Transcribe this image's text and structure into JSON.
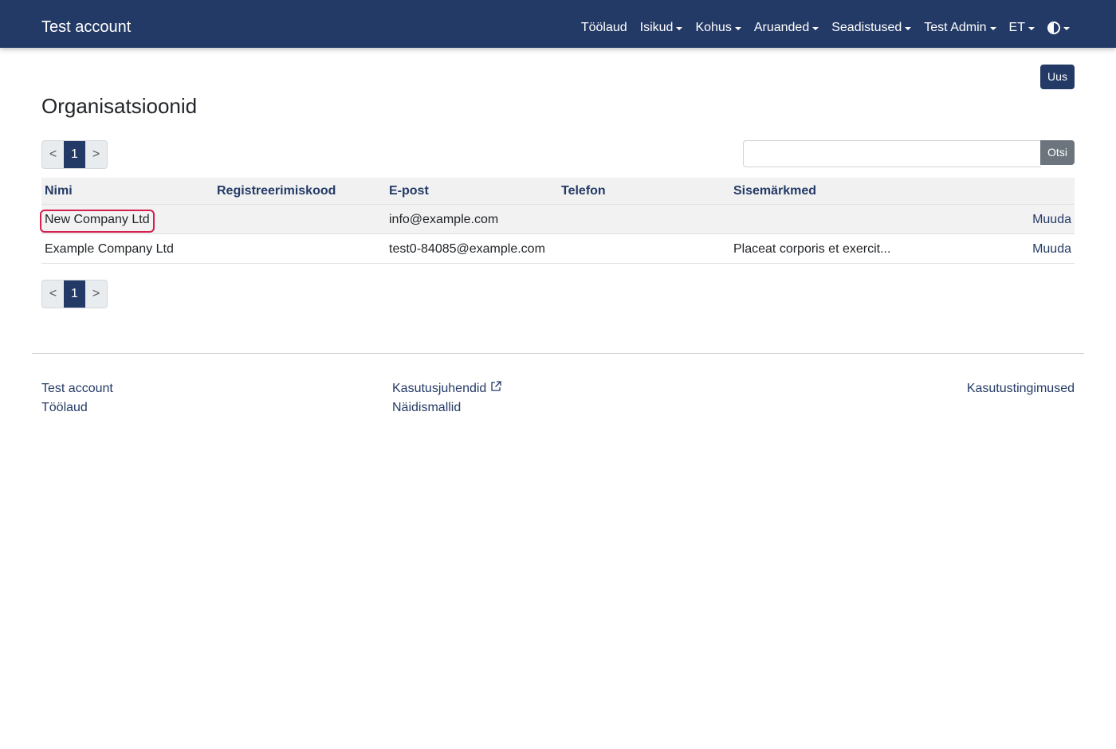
{
  "navbar": {
    "brand": "Test account",
    "items": [
      {
        "label": "Töölaud",
        "dropdown": false
      },
      {
        "label": "Isikud",
        "dropdown": true
      },
      {
        "label": "Kohus",
        "dropdown": true
      },
      {
        "label": "Aruanded",
        "dropdown": true
      },
      {
        "label": "Seadistused",
        "dropdown": true
      },
      {
        "label": "Test Admin",
        "dropdown": true
      },
      {
        "label": "ET",
        "dropdown": true
      }
    ],
    "theme_icon": "contrast-icon",
    "bg_color": "#243a66"
  },
  "page": {
    "title": "Organisatsioonid",
    "new_button": "Uus"
  },
  "pagination": {
    "prev": "<",
    "current": "1",
    "next": ">"
  },
  "search": {
    "value": "",
    "placeholder": "",
    "button": "Otsi"
  },
  "table": {
    "columns": [
      "Nimi",
      "Registreerimiskood",
      "E-post",
      "Telefon",
      "Sisemärkmed"
    ],
    "rows": [
      {
        "name": "New Company Ltd",
        "reg_code": "",
        "email": "info@example.com",
        "phone": "",
        "notes": "",
        "action": "Muuda",
        "highlighted": true
      },
      {
        "name": "Example Company Ltd",
        "reg_code": "",
        "email": "test0-84085@example.com",
        "phone": "",
        "notes": "Placeat corporis et exercit...",
        "action": "Muuda",
        "highlighted": false
      }
    ]
  },
  "footer": {
    "col1": [
      "Test account",
      "Töölaud"
    ],
    "col2": [
      "Kasutusjuhendid",
      "Näidismallid"
    ],
    "col3": [
      "Kasutustingimused"
    ],
    "external_icon": "external-link-icon"
  },
  "colors": {
    "primary": "#243a66",
    "secondary": "#6c757d",
    "highlight": "#d6204d"
  }
}
